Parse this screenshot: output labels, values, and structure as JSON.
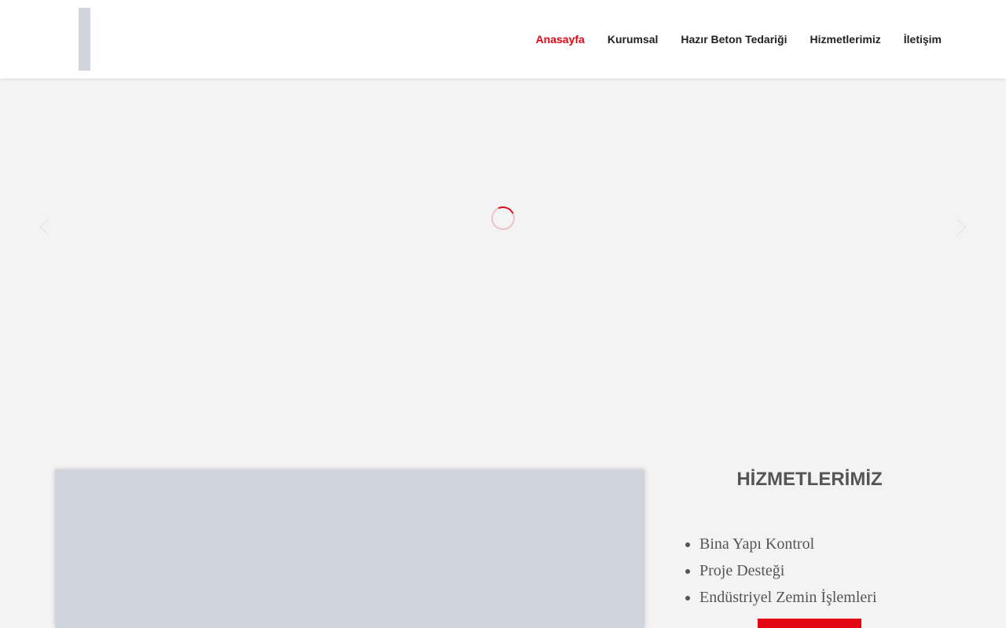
{
  "header": {
    "nav": [
      {
        "label": "Anasayfa",
        "active": true
      },
      {
        "label": "Kurumsal",
        "active": false
      },
      {
        "label": "Hazır Beton Tedariği",
        "active": false
      },
      {
        "label": "Hizmetlerimiz",
        "active": false
      },
      {
        "label": "İletişim",
        "active": false
      }
    ]
  },
  "services": {
    "title": "HİZMETLERİMİZ",
    "items": [
      "Bina Yapı Kontrol",
      "Proje Desteği",
      "Endüstriyel Zemin İşlemleri"
    ]
  },
  "colors": {
    "accent": "#e30613",
    "background": "#f3f3f3",
    "placeholder": "#d0d5dd",
    "text": "#555555"
  },
  "icons": {
    "loader": "loading-spinner-icon",
    "prev": "chevron-left-icon",
    "next": "chevron-right-icon"
  }
}
